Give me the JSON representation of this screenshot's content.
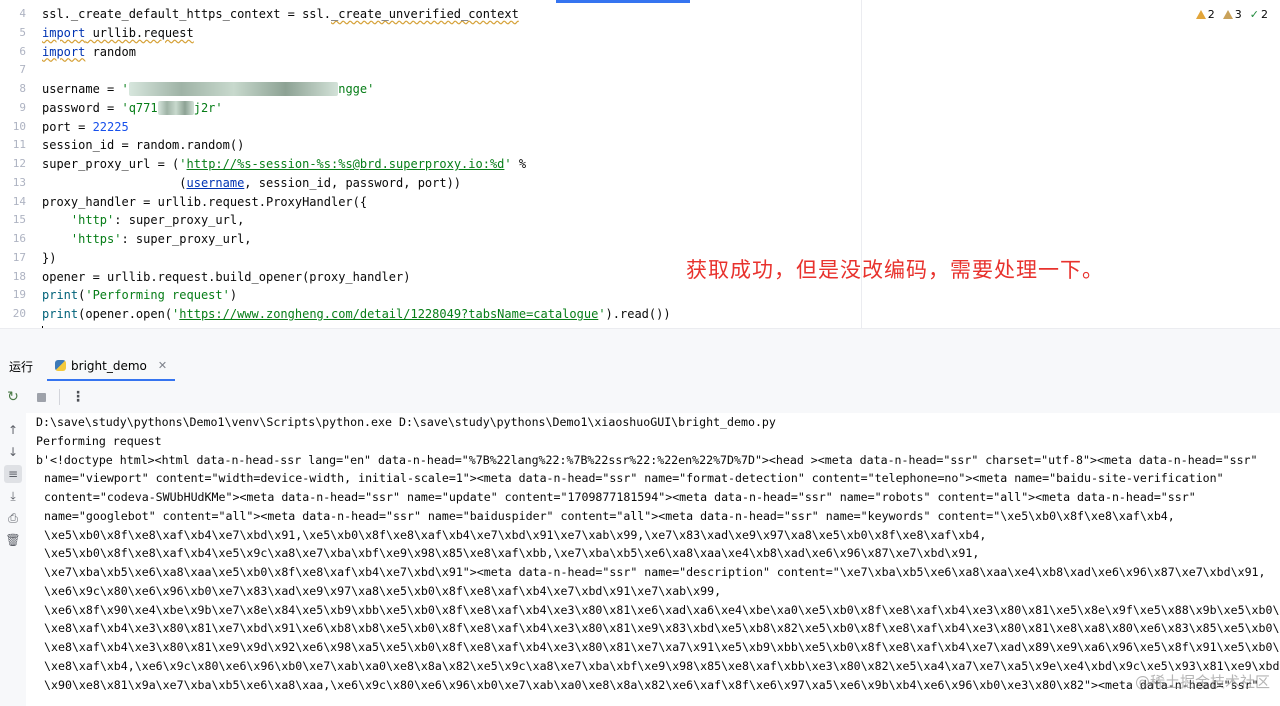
{
  "editor": {
    "line_numbers": [
      "4",
      "5",
      "6",
      "7",
      "8",
      "9",
      "10",
      "11",
      "12",
      "13",
      "14",
      "15",
      "16",
      "17",
      "18",
      "19",
      "20"
    ],
    "lines": {
      "l4": {
        "a": "ssl._create_default_https_context = ssl.",
        "b": "_create_unverified_context"
      },
      "l5": {
        "kw": "import",
        "rest": " urllib.request"
      },
      "l6": {
        "kw": "import",
        "rest": " random"
      },
      "l8": {
        "a": "username = ",
        "s1": "'",
        "s3": "ngge'"
      },
      "l9": {
        "a": "password = ",
        "s1": "'q771",
        "s3": "j2r'"
      },
      "l10": {
        "a": "port = ",
        "num": "22225"
      },
      "l11": {
        "a": "session_id = random.random()"
      },
      "l12": {
        "a": "super_proxy_url = (",
        "q1": "'",
        "url": "http://%s-session-%s:%s@brd.superproxy.io:%d",
        "q2": "'",
        "b": " %"
      },
      "l13": {
        "indent": "                   (",
        "param": "username",
        "b": ", session_id, password, port))"
      },
      "l14": {
        "a": "proxy_handler = urllib.request.ProxyHandler({"
      },
      "l15": {
        "indent": "    ",
        "str": "'http'",
        "b": ": super_proxy_url,"
      },
      "l16": {
        "indent": "    ",
        "str": "'https'",
        "b": ": super_proxy_url,"
      },
      "l17": {
        "a": "})"
      },
      "l18": {
        "a": "opener = urllib.request.build_opener(proxy_handler)"
      },
      "l19": {
        "fn": "print",
        "a": "(",
        "str": "'Performing request'",
        "b": ")"
      },
      "l20": {
        "fn": "print",
        "a": "(opener.open(",
        "q1": "'",
        "url": "https://www.zongheng.com/detail/1228049?tabsName=catalogue",
        "q2": "'",
        "b": ").read())"
      }
    },
    "inspections": {
      "warnings": "2",
      "weak_warnings": "3",
      "typos": "2"
    },
    "annotation": "获取成功，但是没改编码，需要处理一下。"
  },
  "run": {
    "title": "运行",
    "tab_label": "bright_demo",
    "console_lines": [
      "D:\\save\\study\\pythons\\Demo1\\venv\\Scripts\\python.exe D:\\save\\study\\pythons\\Demo1\\xiaoshuoGUI\\bright_demo.py",
      "Performing request",
      "b'<!doctype html><html data-n-head-ssr lang=\"en\" data-n-head=\"%7B%22lang%22:%7B%22ssr%22:%22en%22%7D%7D\"><head ><meta data-n-head=\"ssr\" charset=\"utf-8\"><meta data-n-head=\"ssr\"",
      "name=\"viewport\" content=\"width=device-width, initial-scale=1\"><meta data-n-head=\"ssr\" name=\"format-detection\" content=\"telephone=no\"><meta name=\"baidu-site-verification\"",
      "content=\"codeva-SWUbHUdKMe\"><meta data-n-head=\"ssr\" name=\"update\" content=\"1709877181594\"><meta data-n-head=\"ssr\" name=\"robots\" content=\"all\"><meta data-n-head=\"ssr\"",
      "name=\"googlebot\" content=\"all\"><meta data-n-head=\"ssr\" name=\"baiduspider\" content=\"all\"><meta data-n-head=\"ssr\" name=\"keywords\" content=\"\\xe5\\xb0\\x8f\\xe8\\xaf\\xb4,",
      "\\xe5\\xb0\\x8f\\xe8\\xaf\\xb4\\xe7\\xbd\\x91,\\xe5\\xb0\\x8f\\xe8\\xaf\\xb4\\xe7\\xbd\\x91\\xe7\\xab\\x99,\\xe7\\x83\\xad\\xe9\\x97\\xa8\\xe5\\xb0\\x8f\\xe8\\xaf\\xb4,",
      "\\xe5\\xb0\\x8f\\xe8\\xaf\\xb4\\xe5\\x9c\\xa8\\xe7\\xba\\xbf\\xe9\\x98\\x85\\xe8\\xaf\\xbb,\\xe7\\xba\\xb5\\xe6\\xa8\\xaa\\xe4\\xb8\\xad\\xe6\\x96\\x87\\xe7\\xbd\\x91,",
      "\\xe7\\xba\\xb5\\xe6\\xa8\\xaa\\xe5\\xb0\\x8f\\xe8\\xaf\\xb4\\xe7\\xbd\\x91\"><meta data-n-head=\"ssr\" name=\"description\" content=\"\\xe7\\xba\\xb5\\xe6\\xa8\\xaa\\xe4\\xb8\\xad\\xe6\\x96\\x87\\xe7\\xbd\\x91,",
      "\\xe6\\x9c\\x80\\xe6\\x96\\xb0\\xe7\\x83\\xad\\xe9\\x97\\xa8\\xe5\\xb0\\x8f\\xe8\\xaf\\xb4\\xe7\\xbd\\x91\\xe7\\xab\\x99,",
      "\\xe6\\x8f\\x90\\xe4\\xbe\\x9b\\xe7\\x8e\\x84\\xe5\\xb9\\xbb\\xe5\\xb0\\x8f\\xe8\\xaf\\xb4\\xe3\\x80\\x81\\xe6\\xad\\xa6\\xe4\\xbe\\xa0\\xe5\\xb0\\x8f\\xe8\\xaf\\xb4\\xe3\\x80\\x81\\xe5\\x8e\\x9f\\xe5\\x88\\x9b\\xe5\\xb0\\x8f",
      "\\xe8\\xaf\\xb4\\xe3\\x80\\x81\\xe7\\xbd\\x91\\xe6\\xb8\\xb8\\xe5\\xb0\\x8f\\xe8\\xaf\\xb4\\xe3\\x80\\x81\\xe9\\x83\\xbd\\xe5\\xb8\\x82\\xe5\\xb0\\x8f\\xe8\\xaf\\xb4\\xe3\\x80\\x81\\xe8\\xa8\\x80\\xe6\\x83\\x85\\xe5\\xb0\\x8f",
      "\\xe8\\xaf\\xb4\\xe3\\x80\\x81\\xe9\\x9d\\x92\\xe6\\x98\\xa5\\xe5\\xb0\\x8f\\xe8\\xaf\\xb4\\xe3\\x80\\x81\\xe7\\xa7\\x91\\xe5\\xb9\\xbb\\xe5\\xb0\\x8f\\xe8\\xaf\\xb4\\xe7\\xad\\x89\\xe9\\xa6\\x96\\xe5\\x8f\\x91\\xe5\\xb0\\x8f",
      "\\xe8\\xaf\\xb4,\\xe6\\x9c\\x80\\xe6\\x96\\xb0\\xe7\\xab\\xa0\\xe8\\x8a\\x82\\xe5\\x9c\\xa8\\xe7\\xba\\xbf\\xe9\\x98\\x85\\xe8\\xaf\\xbb\\xe3\\x80\\x82\\xe5\\xa4\\xa7\\xe7\\xa5\\x9e\\xe4\\xbd\\x9c\\xe5\\x93\\x81\\xe9\\xbd",
      "\\x90\\xe8\\x81\\x9a\\xe7\\xba\\xb5\\xe6\\xa8\\xaa,\\xe6\\x9c\\x80\\xe6\\x96\\xb0\\xe7\\xab\\xa0\\xe8\\x8a\\x82\\xe6\\xaf\\x8f\\xe6\\x97\\xa5\\xe6\\x9b\\xb4\\xe6\\x96\\xb0\\xe3\\x80\\x82\"><meta data-n-head=\"ssr\""
    ]
  },
  "watermark": "@稀土掘金技术社区"
}
